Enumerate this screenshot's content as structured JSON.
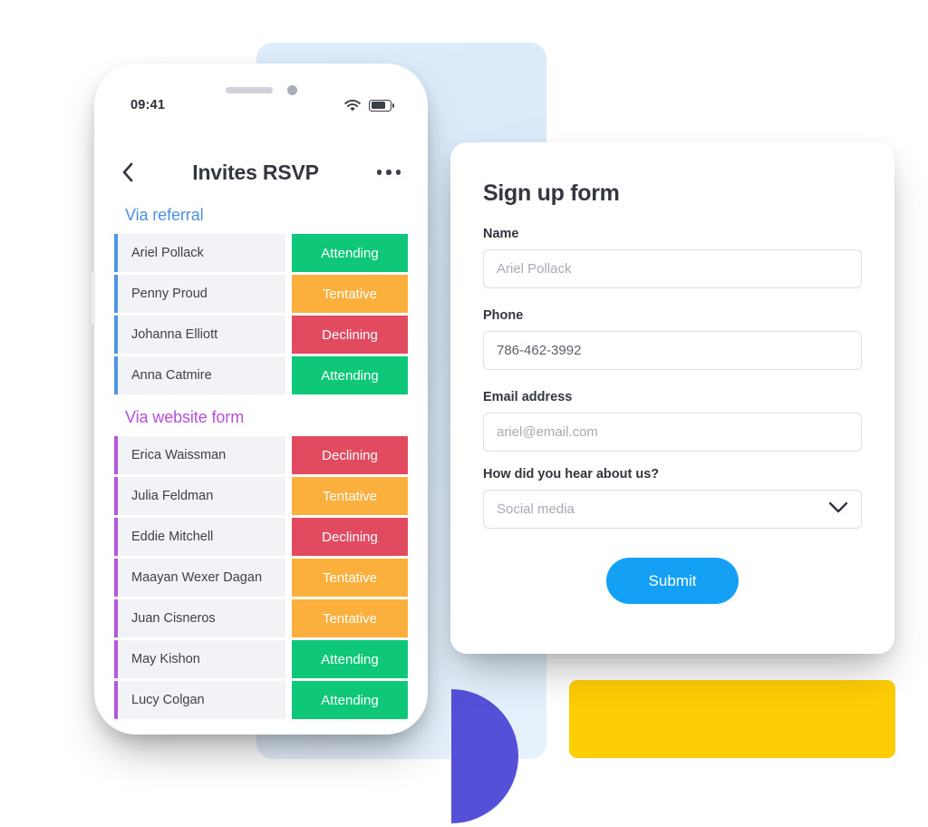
{
  "phone": {
    "status_bar": {
      "time": "09:41",
      "wifi_icon": "wifi-icon",
      "battery_icon": "battery-icon",
      "battery_level": 75
    },
    "nav": {
      "back_icon": "chevron-left-icon",
      "title": "Invites RSVP",
      "more_icon": "more-options-icon"
    },
    "sections": [
      {
        "title": "Via referral",
        "accent": "#4d95ea",
        "rows": [
          {
            "name": "Ariel Pollack",
            "status": "Attending"
          },
          {
            "name": "Penny Proud",
            "status": "Tentative"
          },
          {
            "name": "Johanna Elliott",
            "status": "Declining"
          },
          {
            "name": "Anna Catmire",
            "status": "Attending"
          }
        ]
      },
      {
        "title": "Via website form",
        "accent": "#b556df",
        "rows": [
          {
            "name": "Erica Waissman",
            "status": "Declining"
          },
          {
            "name": "Julia Feldman",
            "status": "Tentative"
          },
          {
            "name": "Eddie Mitchell",
            "status": "Declining"
          },
          {
            "name": "Maayan Wexer Dagan",
            "status": "Tentative"
          },
          {
            "name": "Juan Cisneros",
            "status": "Tentative"
          },
          {
            "name": "May Kishon",
            "status": "Attending"
          },
          {
            "name": "Lucy Colgan",
            "status": "Attending"
          }
        ]
      }
    ],
    "status_colors": {
      "Attending": "#0fc778",
      "Tentative": "#fbaf3c",
      "Declining": "#e24a60"
    }
  },
  "form": {
    "title": "Sign up form",
    "fields": [
      {
        "label": "Name",
        "value": "Ariel Pollack",
        "filled": false
      },
      {
        "label": "Phone",
        "value": "786-462-3992",
        "filled": true
      },
      {
        "label": "Email address",
        "value": "ariel@email.com",
        "filled": false
      }
    ],
    "select": {
      "label": "How did you hear about us?",
      "value": "Social media",
      "chevron_icon": "chevron-down-icon"
    },
    "submit_label": "Submit",
    "submit_color": "#14a1f5"
  },
  "decor": {
    "blue_card_color": "#dcecfa",
    "purple_semicircle_color": "#5550d8",
    "yellow_rect_color": "#ffcd05"
  }
}
